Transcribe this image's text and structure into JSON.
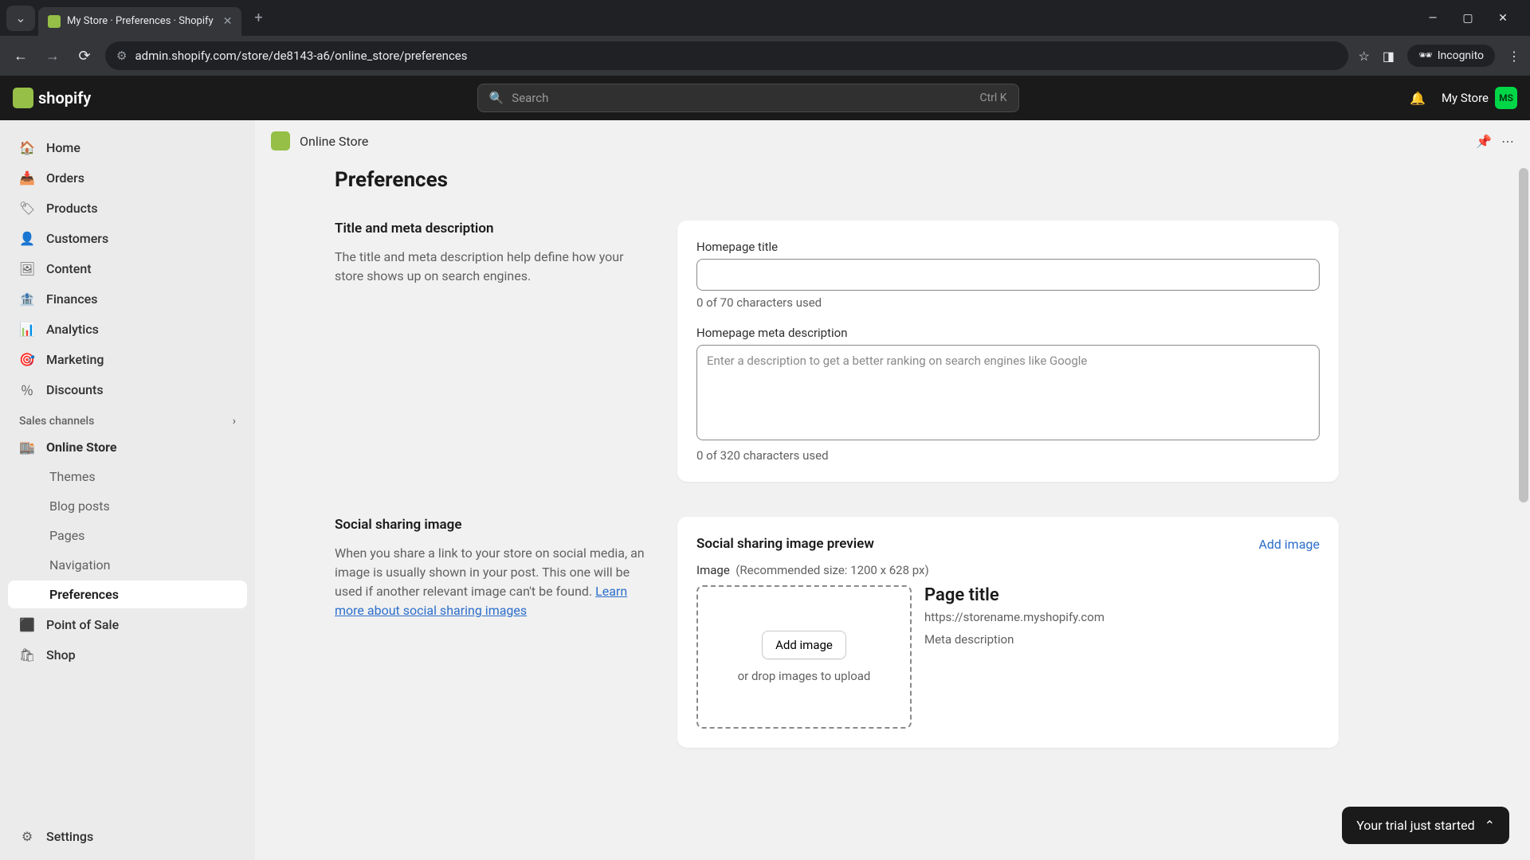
{
  "browser": {
    "tab_title": "My Store · Preferences · Shopify",
    "url": "admin.shopify.com/store/de8143-a6/online_store/preferences",
    "incognito_label": "Incognito"
  },
  "header": {
    "logo_text": "shopify",
    "search_placeholder": "Search",
    "search_kbd": "Ctrl K",
    "store_name": "My Store",
    "avatar_initials": "MS"
  },
  "sidebar": {
    "items": [
      {
        "label": "Home"
      },
      {
        "label": "Orders"
      },
      {
        "label": "Products"
      },
      {
        "label": "Customers"
      },
      {
        "label": "Content"
      },
      {
        "label": "Finances"
      },
      {
        "label": "Analytics"
      },
      {
        "label": "Marketing"
      },
      {
        "label": "Discounts"
      }
    ],
    "channels_label": "Sales channels",
    "online_store_label": "Online Store",
    "online_store_sub": [
      {
        "label": "Themes"
      },
      {
        "label": "Blog posts"
      },
      {
        "label": "Pages"
      },
      {
        "label": "Navigation"
      },
      {
        "label": "Preferences"
      }
    ],
    "pos_label": "Point of Sale",
    "shop_label": "Shop",
    "settings_label": "Settings"
  },
  "topbar": {
    "channel": "Online Store"
  },
  "page": {
    "title": "Preferences",
    "section1": {
      "heading": "Title and meta description",
      "desc": "The title and meta description help define how your store shows up on search engines.",
      "title_label": "Homepage title",
      "title_help": "0 of 70 characters used",
      "meta_label": "Homepage meta description",
      "meta_placeholder": "Enter a description to get a better ranking on search engines like Google",
      "meta_help": "0 of 320 characters used"
    },
    "section2": {
      "heading": "Social sharing image",
      "desc_pre": "When you share a link to your store on social media, an image is usually shown in your post. This one will be used if another relevant image can't be found. ",
      "desc_link": "Learn more about social sharing images",
      "card_title": "Social sharing image preview",
      "add_image_link": "Add image",
      "image_label": "Image",
      "image_size": "(Recommended size: 1200 x 628 px)",
      "add_image_btn": "Add image",
      "drop_text": "or drop images to upload",
      "preview_title": "Page title",
      "preview_url": "https://storename.myshopify.com",
      "preview_meta": "Meta description"
    }
  },
  "toast": {
    "text": "Your trial just started"
  }
}
